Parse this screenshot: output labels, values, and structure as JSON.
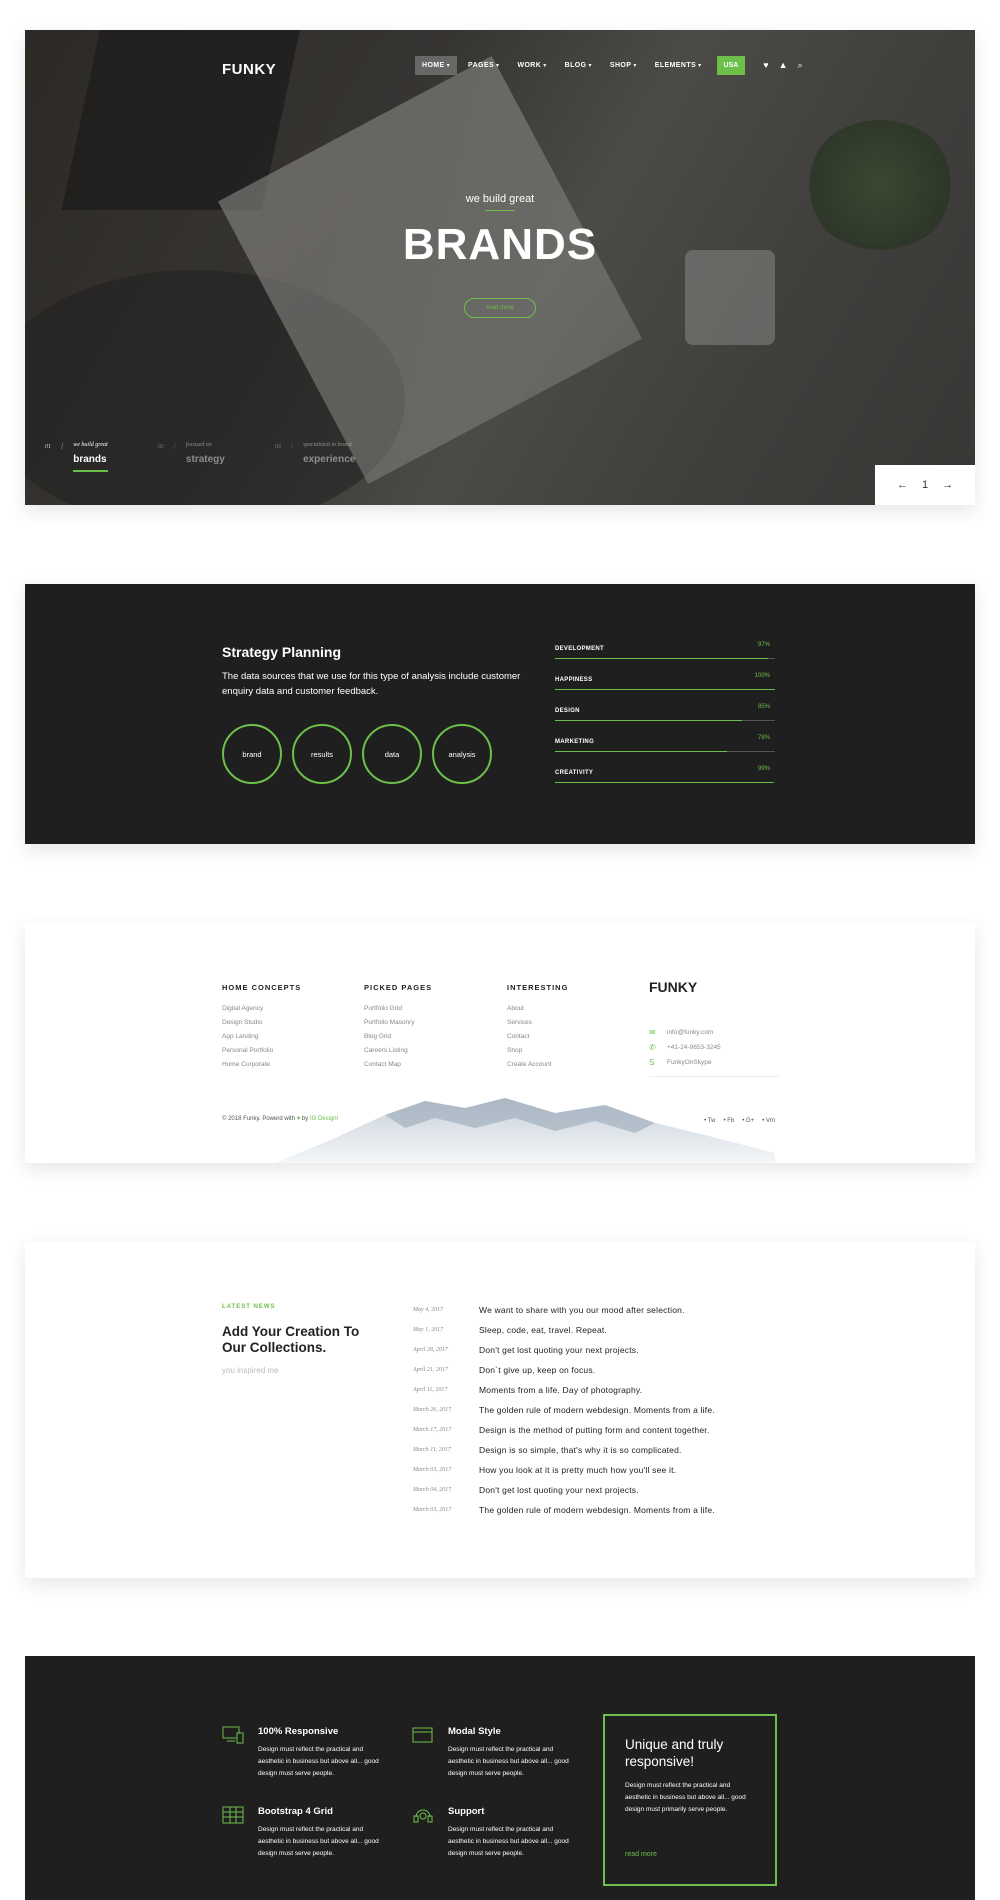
{
  "hero": {
    "logo": "FUNKY",
    "nav": [
      {
        "label": "HOME",
        "active": true
      },
      {
        "label": "PAGES"
      },
      {
        "label": "WORK"
      },
      {
        "label": "BLOG"
      },
      {
        "label": "SHOP"
      },
      {
        "label": "ELEMENTS"
      }
    ],
    "badge": "USA",
    "pretitle": "we build great",
    "title": "BRANDS",
    "button": "read more",
    "slides": [
      {
        "num": "01",
        "sub": "we build great",
        "main": "brands"
      },
      {
        "num": "02",
        "sub": "focused on",
        "main": "strategy"
      },
      {
        "num": "03",
        "sub": "specialized in brand",
        "main": "experience"
      }
    ],
    "pager": {
      "prev": "←",
      "current": "1",
      "next": "→"
    }
  },
  "strategy": {
    "title": "Strategy Planning",
    "description": "The data sources that we use for this type of analysis include customer enquiry data and customer feedback.",
    "circles": [
      "brand",
      "results",
      "data",
      "analysis"
    ],
    "bars": [
      {
        "label": "DEVELOPMENT",
        "pct_label": "97%",
        "value": 97
      },
      {
        "label": "HAPPINESS",
        "pct_label": "100%",
        "value": 100
      },
      {
        "label": "DESIGN",
        "pct_label": "85%",
        "value": 85
      },
      {
        "label": "MARKETING",
        "pct_label": "78%",
        "value": 78
      },
      {
        "label": "CREATIVITY",
        "pct_label": "99%",
        "value": 99
      }
    ]
  },
  "footer": {
    "columns": [
      {
        "title": "HOME CONCEPTS",
        "items": [
          "Digital Agency",
          "Design Studio",
          "App Landing",
          "Personal Portfolio",
          "Home Corporate"
        ]
      },
      {
        "title": "PICKED PAGES",
        "items": [
          "Portfolio Grid",
          "Portfolio Masonry",
          "Blog Grid",
          "Careers Listing",
          "Contact Map"
        ]
      },
      {
        "title": "INTERESTING",
        "items": [
          "About",
          "Services",
          "Contact",
          "Shop",
          "Create Account"
        ]
      }
    ],
    "logo": "FUNKY",
    "contacts": [
      {
        "icon": "envelope-icon",
        "glyph": "✉",
        "text": "info@funky.com"
      },
      {
        "icon": "phone-icon",
        "glyph": "✆",
        "text": "+41-24-9653-3245"
      },
      {
        "icon": "skype-icon",
        "glyph": "S",
        "text": "FunkyOnSkype"
      }
    ],
    "copyright_pre": "© 2018 Funky. Powerd with",
    "copyright_by": "by",
    "copyright_author": "IG Design!",
    "socials": [
      "Tw",
      "Fb",
      "G+",
      "Vm"
    ]
  },
  "news": {
    "tag": "LATEST NEWS",
    "title": "Add Your Creation To Our Collections.",
    "subtitle": "you inspired me",
    "items": [
      {
        "date": "May 4, 2017",
        "text": "We want to share with you our mood after selection."
      },
      {
        "date": "May 1, 2017",
        "text": "Sleep, code, eat, travel. Repeat."
      },
      {
        "date": "April 28, 2017",
        "text": "Don't get lost quoting your next projects."
      },
      {
        "date": "April 21, 2017",
        "text": "Don´t give up, keep on focus."
      },
      {
        "date": "April 11, 2017",
        "text": "Moments from a life. Day of photography."
      },
      {
        "date": "March 26, 2017",
        "text": "The golden rule of modern webdesign. Moments from a life."
      },
      {
        "date": "March 17, 2017",
        "text": "Design is the method of putting form and content together."
      },
      {
        "date": "March 11, 2017",
        "text": "Design is so simple, that's why it is so complicated."
      },
      {
        "date": "March 03, 2017",
        "text": "How you look at it is pretty much how you'll see it."
      },
      {
        "date": "March 04, 2017",
        "text": "Don't get lost quoting your next projects."
      },
      {
        "date": "March 03, 2017",
        "text": "The golden rule of modern webdesign. Moments from a life."
      }
    ]
  },
  "features": {
    "items": [
      {
        "title": "100% Responsive",
        "text": "Design must reflect the practical and aesthetic in business but above all... good design must serve people."
      },
      {
        "title": "Modal Style",
        "text": "Design must reflect the practical and aesthetic in business but above all... good design must serve people."
      },
      {
        "title": "Bootstrap 4 Grid",
        "text": "Design must reflect the practical and aesthetic in business but above all... good design must serve people."
      },
      {
        "title": "Support",
        "text": "Design must reflect the practical and aesthetic in business but above all... good design must serve people."
      }
    ],
    "promo": {
      "title": "Unique and truly responsive!",
      "text": "Design must reflect the practical and aesthetic in business but above all... good design must primarily serve people.",
      "link": "read more"
    }
  },
  "colors": {
    "accent": "#6cc04a",
    "dark": "#1f1f1f"
  }
}
